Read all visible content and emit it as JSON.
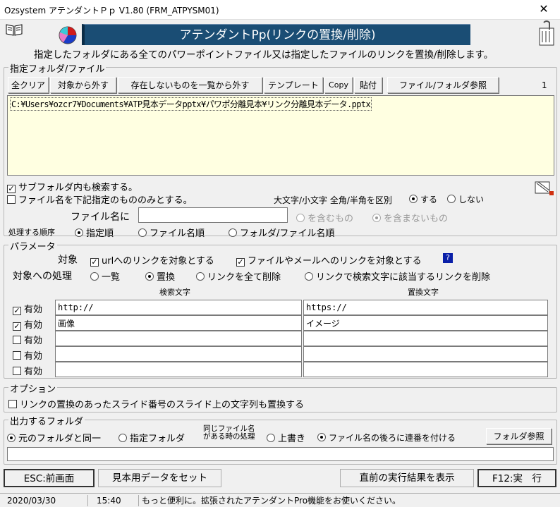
{
  "window": {
    "title": "Ozsystem アテンダントＰｐ V1.80 (FRM_ATPYSM01)",
    "close_glyph": "✕"
  },
  "banner": "アテンダントPp(リンクの置換/削除)",
  "description": "指定したフォルダにある全てのパワーポイントファイル又は指定したファイルのリンクを置換/削除します。",
  "folder_group": {
    "label": "指定フォルダ/ファイル",
    "buttons": {
      "clear_all": "全クリア",
      "remove_target": "対象から外す",
      "remove_missing": "存在しないものを一覧から外す",
      "template": "テンプレート",
      "copy": "Copy",
      "paste": "貼付",
      "browse": "ファイル/フォルダ参照"
    },
    "count": "1",
    "files": [
      "C:¥Users¥ozcr7¥Documents¥ATP見本データpptx¥パワポ分離見本¥リンク分離見本データ.pptx"
    ]
  },
  "options_top": {
    "subfolder": "サブフォルダ内も検索する。",
    "filename_only": "ファイル名を下記指定のもののみとする。",
    "case_label": "大文字/小文字 全角/半角を区別",
    "case_yes": "する",
    "case_no": "しない",
    "filename_label": "ファイル名に",
    "filename_value": "",
    "contains": "を含むもの",
    "not_contains": "を含まないもの",
    "order_label": "処理する順序",
    "order_specified": "指定順",
    "order_filename": "ファイル名順",
    "order_folder_file": "フォルダ/ファイル名順"
  },
  "params": {
    "label": "パラメータ",
    "target_label": "対象",
    "url_links": "urlへのリンクを対象とする",
    "file_mail_links": "ファイルやメールへのリンクを対象とする",
    "help": "?",
    "process_label": "対象への処理",
    "proc_list": "一覧",
    "proc_replace": "置換",
    "proc_delete_all": "リンクを全て削除",
    "proc_delete_match": "リンクで検索文字に該当するリンクを削除",
    "search_header": "検索文字",
    "replace_header": "置換文字",
    "enabled_label": "有効",
    "rows": [
      {
        "enabled": true,
        "search": "http://",
        "replace": "https://"
      },
      {
        "enabled": true,
        "search": "画像",
        "replace": "イメージ"
      },
      {
        "enabled": false,
        "search": "",
        "replace": ""
      },
      {
        "enabled": false,
        "search": "",
        "replace": ""
      },
      {
        "enabled": false,
        "search": "",
        "replace": ""
      }
    ]
  },
  "option_group": {
    "label": "オプション",
    "replace_slide_text": "リンクの置換のあったスライド番号のスライド上の文字列も置換する"
  },
  "output": {
    "label": "出力するフォルダ",
    "same_folder": "元のフォルダと同一",
    "specified_folder": "指定フォルダ",
    "same_name_line1": "同じファイル名",
    "same_name_line2": "がある時の処理",
    "overwrite": "上書き",
    "append_number": "ファイル名の後ろに連番を付ける",
    "browse": "フォルダ参照",
    "path": ""
  },
  "footer": {
    "esc": "ESC:前画面",
    "sample": "見本用データをセット",
    "last_result": "直前の実行結果を表示",
    "f12": "F12:実　行"
  },
  "status": {
    "date": "2020/03/30",
    "time": "15:40",
    "message": "もっと便利に。拡張されたアテンダントPro機能をお使いください。"
  },
  "colors": {
    "banner": "#1a4d74",
    "listbox": "#ffffe1",
    "help": "#0a1fa8"
  }
}
